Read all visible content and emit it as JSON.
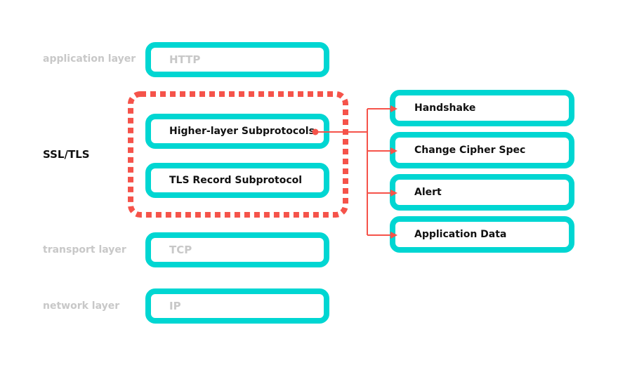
{
  "colors": {
    "accent_box": "#00d6d2",
    "connector": "#f5534a",
    "muted_text": "#c8c8c8",
    "dark_text": "#111111"
  },
  "layers": {
    "application": {
      "label": "application layer",
      "protocol": "HTTP"
    },
    "ssl_tls": {
      "label": "SSL/TLS",
      "higher": "Higher-layer Subprotocols",
      "record": "TLS Record Subprotocol"
    },
    "transport": {
      "label": "transport layer",
      "protocol": "TCP"
    },
    "network": {
      "label": "network layer",
      "protocol": "IP"
    }
  },
  "subprotocols": [
    "Handshake",
    "Change Cipher Spec",
    "Alert",
    "Application Data"
  ]
}
